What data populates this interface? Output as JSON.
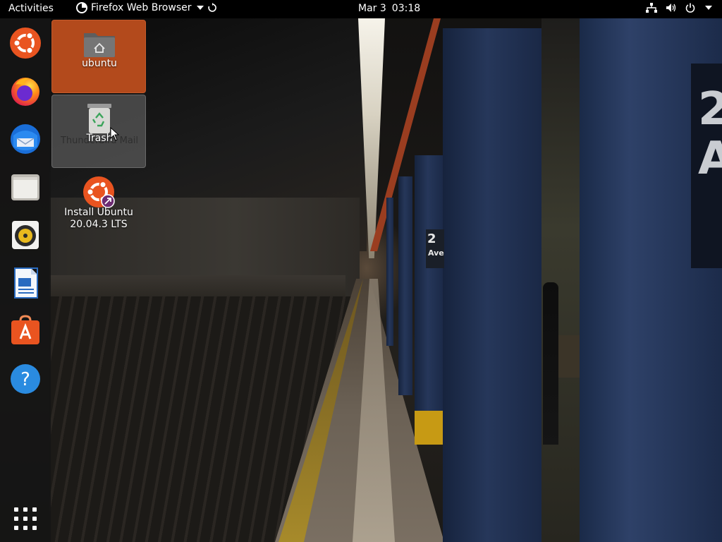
{
  "topbar": {
    "activities": "Activities",
    "app_name": "Firefox Web Browser",
    "date": "Mar 3",
    "time": "03:18",
    "icons": [
      "network-icon",
      "volume-icon",
      "power-icon",
      "system-menu-chevron-icon"
    ]
  },
  "dock": {
    "items": [
      {
        "name": "ubuntu-installer",
        "icon": "ubuntu-logo-icon"
      },
      {
        "name": "firefox",
        "icon": "firefox-icon"
      },
      {
        "name": "thunderbird",
        "icon": "thunderbird-icon"
      },
      {
        "name": "files",
        "icon": "files-icon"
      },
      {
        "name": "rhythmbox",
        "icon": "rhythmbox-icon"
      },
      {
        "name": "libreoffice-writer",
        "icon": "writer-icon"
      },
      {
        "name": "ubuntu-software",
        "icon": "software-icon"
      },
      {
        "name": "help",
        "icon": "help-icon"
      }
    ],
    "show_apps": "show-applications-icon"
  },
  "desktop": {
    "icons": [
      {
        "label": "ubuntu",
        "icon": "home-folder-icon",
        "state": "selected"
      },
      {
        "label": "Trash",
        "icon": "trash-icon",
        "state": "hover"
      },
      {
        "label": "Install Ubuntu\n20.04.3 LTS",
        "icon": "ubuntu-install-icon",
        "state": "normal"
      }
    ],
    "trash_ghost_label": "Thunderbird Mail"
  },
  "wallpaper": {
    "sign_large": "2\nA",
    "sign_small": "2",
    "sign_small_sub": "Ave"
  },
  "colors": {
    "accent": "#E95420",
    "selected_bg": "#B34A1C",
    "topbar_bg": "#000000",
    "dock_bg": "#141414"
  }
}
